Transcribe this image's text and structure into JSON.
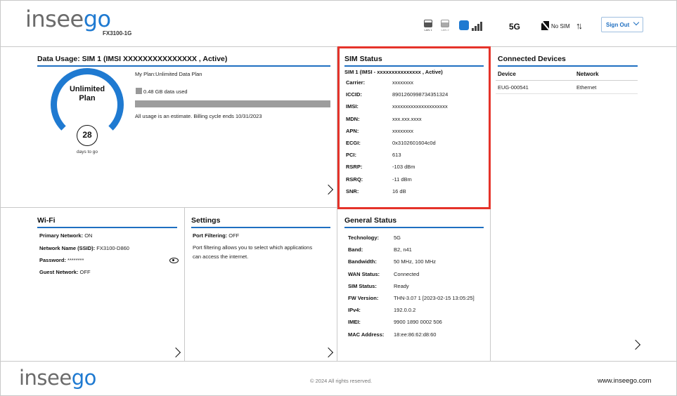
{
  "header": {
    "logo_main": "insee",
    "logo_accent": "go",
    "model": "FX3100-1G",
    "lan1_label": "LAN 1",
    "lan2_label": "LAN 2",
    "network_type": "5G",
    "sim_state": "No SIM",
    "signout_label": "Sign Out",
    "accent_color": "#1f7ad1"
  },
  "data_usage": {
    "title": "Data Usage:  SIM 1 (IMSI   XXXXXXXXXXXXXXX , Active)",
    "plan_line1": "Unlimited",
    "plan_line2": "Plan",
    "days_left": "28",
    "days_label": "days to go",
    "my_plan": "My Plan:Unlimited Data Plan",
    "data_used": "0.48 GB data used",
    "usage_fraction": 0,
    "billing_note": "All usage is an estimate. Billing cycle ends 10/31/2023"
  },
  "sim_status": {
    "title": "SIM Status",
    "subtitle": "SIM 1 (IMSI -   xxxxxxxxxxxxxxx , Active)",
    "rows": [
      {
        "k": "Carrier:",
        "v": "xxxxxxxx"
      },
      {
        "k": "ICCID:",
        "v": "8901260998734351324"
      },
      {
        "k": "IMSI:",
        "v": "xxxxxxxxxxxxxxxxxxxxx"
      },
      {
        "k": "MDN:",
        "v": "xxx.xxx.xxxx"
      },
      {
        "k": "APN:",
        "v": "xxxxxxxx"
      },
      {
        "k": "ECGI:",
        "v": "0x3102601604c0d"
      },
      {
        "k": "PCI:",
        "v": "613"
      },
      {
        "k": "RSRP:",
        "v": "-103 dBm"
      },
      {
        "k": "RSRQ:",
        "v": "-11 dBm"
      },
      {
        "k": "SNR:",
        "v": "16 dB"
      }
    ]
  },
  "connected_devices": {
    "title": "Connected Devices",
    "col_device": "Device",
    "col_network": "Network",
    "rows": [
      {
        "device": "EUG-000541",
        "network": "Ethernet"
      }
    ]
  },
  "wifi": {
    "title": "Wi-Fi",
    "primary_k": "Primary Network:",
    "primary_v": "ON",
    "ssid_k": "Network Name (SSID):",
    "ssid_v": "FX3100-D860",
    "password_k": "Password:",
    "password_v": "********",
    "guest_k": "Guest Network:",
    "guest_v": "OFF"
  },
  "settings": {
    "title": "Settings",
    "port_k": "Port Filtering:",
    "port_v": "OFF",
    "desc_line1": "Port filtering allows you to select which applications",
    "desc_line2": "can access the internet."
  },
  "general_status": {
    "title": "General Status",
    "rows": [
      {
        "k": "Technology:",
        "v": "5G"
      },
      {
        "k": "Band:",
        "v": "B2, n41"
      },
      {
        "k": "Bandwidth:",
        "v": "50 MHz, 100 MHz"
      },
      {
        "k": "WAN Status:",
        "v": "Connected"
      },
      {
        "k": "SIM Status:",
        "v": "Ready"
      },
      {
        "k": "FW Version:",
        "v": "THN-3.07 1 [2023-02-15 13:05:25]"
      },
      {
        "k": "IPv4:",
        "v": "192.0.0.2"
      },
      {
        "k": "IMEI:",
        "v": "9900 1890 0002 506"
      },
      {
        "k": "MAC Address:",
        "v": "18:ee:86:62:d8:60"
      }
    ]
  },
  "footer": {
    "logo_main": "insee",
    "logo_accent": "go",
    "copyright": "© 2024 All rights reserved.",
    "website": "www.inseego.com"
  }
}
